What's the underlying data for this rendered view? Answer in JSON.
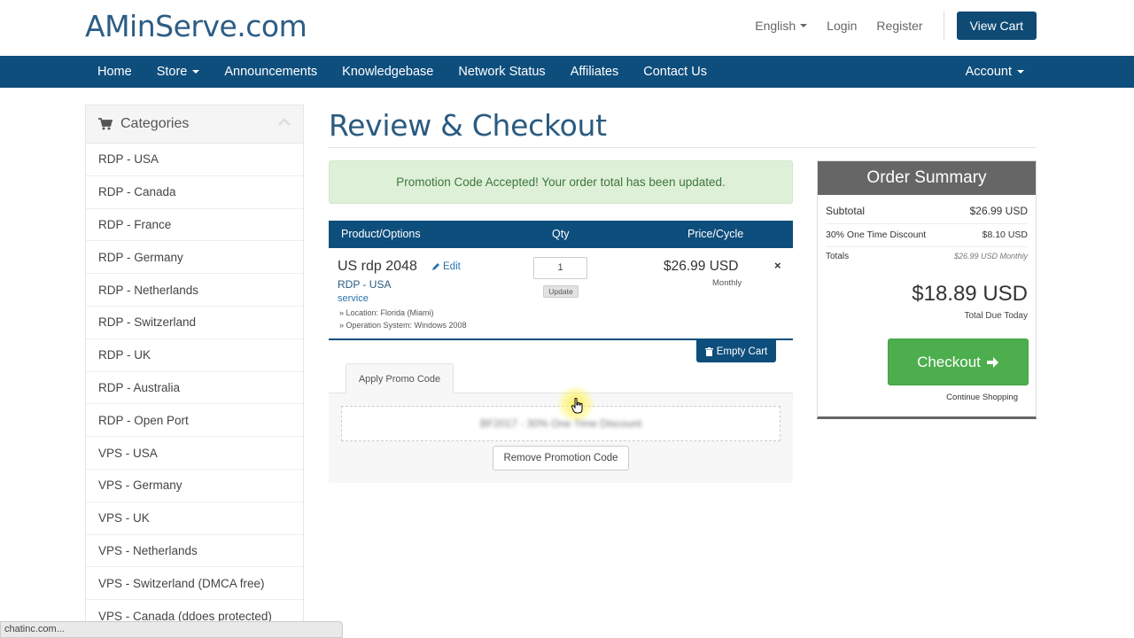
{
  "header": {
    "logo": "AMinServe.com",
    "language": "English",
    "login": "Login",
    "register": "Register",
    "view_cart": "View Cart"
  },
  "nav": {
    "items": [
      "Home",
      "Store",
      "Announcements",
      "Knowledgebase",
      "Network Status",
      "Affiliates",
      "Contact Us"
    ],
    "account": "Account"
  },
  "sidebar": {
    "title": "Categories",
    "items": [
      "RDP - USA",
      "RDP - Canada",
      "RDP - France",
      "RDP - Germany",
      "RDP - Netherlands",
      "RDP - Switzerland",
      "RDP - UK",
      "RDP - Australia",
      "RDP - Open Port",
      "VPS - USA",
      "VPS - Germany",
      "VPS - UK",
      "VPS - Netherlands",
      "VPS - Switzerland (DMCA free)",
      "VPS - Canada (ddoes protected)"
    ]
  },
  "status_bar": "chatinc.com...",
  "main": {
    "title": "Review & Checkout",
    "alert": "Promotion Code Accepted! Your order total has been updated."
  },
  "cart": {
    "headers": {
      "product": "Product/Options",
      "qty": "Qty",
      "price": "Price/Cycle"
    },
    "item": {
      "name": "US rdp 2048",
      "edit": "Edit",
      "group": "RDP - USA",
      "type": "service",
      "options": [
        "» Location: Florida (Miami)",
        "» Operation System: Windows 2008"
      ],
      "qty": "1",
      "update": "Update",
      "price": "$26.99 USD",
      "cycle": "Monthly",
      "remove": "×"
    },
    "empty_cart": "Empty Cart"
  },
  "promo": {
    "tab": "Apply Promo Code",
    "code_text": "BF2017 - 30% One Time Discount",
    "remove": "Remove Promotion Code"
  },
  "summary": {
    "title": "Order Summary",
    "subtotal_label": "Subtotal",
    "subtotal": "$26.99 USD",
    "discount_label": "30% One Time Discount",
    "discount": "$8.10 USD",
    "totals_label": "Totals",
    "totals": "$26.99 USD Monthly",
    "total_due": "$18.89 USD",
    "total_due_label": "Total Due Today",
    "checkout": "Checkout",
    "continue": "Continue Shopping"
  },
  "colors": {
    "brand": "#0e4e7c",
    "logo": "#2c5d86",
    "success_bg": "#dff0d8",
    "success_text": "#3c763d",
    "checkout": "#4cae4c",
    "summary_head": "#666666"
  }
}
